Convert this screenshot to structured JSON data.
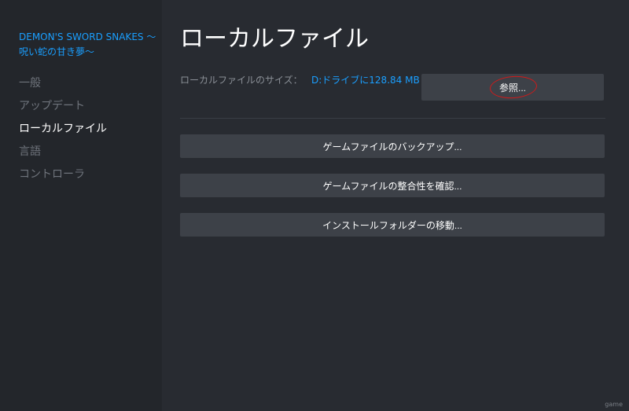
{
  "sidebar": {
    "game_title": "DEMON'S SWORD SNAKES 〜呪い蛇の甘き夢〜",
    "items": [
      {
        "label": "一般",
        "active": false
      },
      {
        "label": "アップデート",
        "active": false
      },
      {
        "label": "ローカルファイル",
        "active": true
      },
      {
        "label": "言語",
        "active": false
      },
      {
        "label": "コントローラ",
        "active": false
      }
    ]
  },
  "main": {
    "title": "ローカルファイル",
    "size_label": "ローカルファイルのサイズ：",
    "size_value": "D:ドライブに128.84 MB",
    "browse_label": "参照...",
    "actions": [
      {
        "label": "ゲームファイルのバックアップ..."
      },
      {
        "label": "ゲームファイルの整合性を確認..."
      },
      {
        "label": "インストールフォルダーの移動..."
      }
    ]
  },
  "watermark": "game",
  "colors": {
    "accent_blue": "#1a9fff",
    "annotation_red": "#d01a1a",
    "active_indicator": "#2fb24a"
  }
}
